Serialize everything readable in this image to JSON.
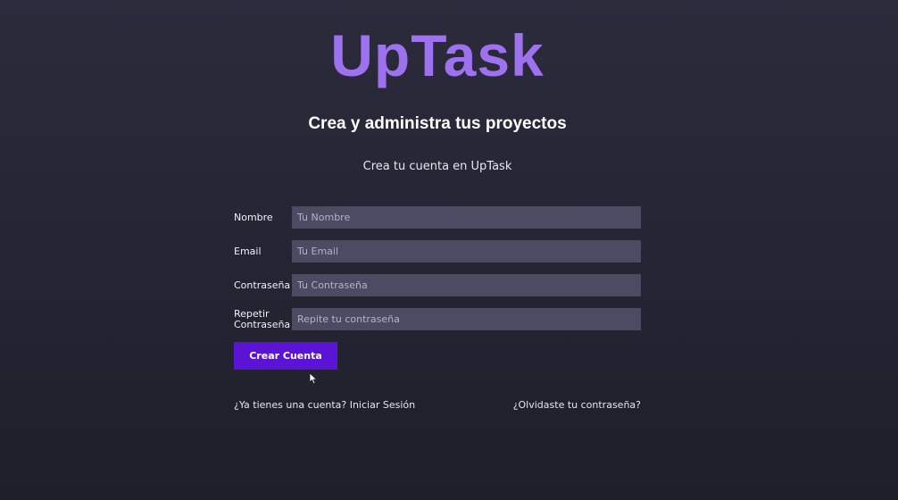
{
  "brand": {
    "logo_text": "UpTask",
    "tagline": "Crea y administra tus proyectos",
    "accent_color": "#9e72ef"
  },
  "page": {
    "subtitle": "Crea tu cuenta en UpTask"
  },
  "form": {
    "fields": [
      {
        "label": "Nombre",
        "placeholder": "Tu Nombre",
        "value": ""
      },
      {
        "label": "Email",
        "placeholder": "Tu Email",
        "value": ""
      },
      {
        "label": "Contraseña",
        "placeholder": "Tu Contraseña",
        "value": ""
      },
      {
        "label": "Repetir Contraseña",
        "placeholder": "Repite tu contraseña",
        "value": ""
      }
    ],
    "submit_label": "Crear Cuenta",
    "submit_color": "#5b14d6"
  },
  "links": {
    "login": "¿Ya tienes una cuenta? Iniciar Sesión",
    "forgot": "¿Olvidaste tu contraseña?"
  },
  "icons": {
    "cursor": "mouse-pointer-icon"
  }
}
